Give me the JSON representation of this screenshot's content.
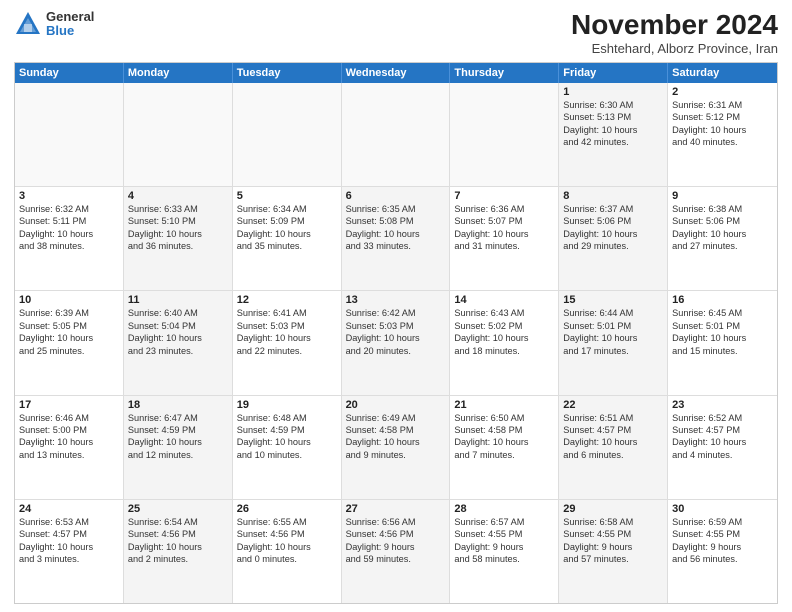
{
  "logo": {
    "general": "General",
    "blue": "Blue"
  },
  "header": {
    "month": "November 2024",
    "location": "Eshtehard, Alborz Province, Iran"
  },
  "weekdays": [
    "Sunday",
    "Monday",
    "Tuesday",
    "Wednesday",
    "Thursday",
    "Friday",
    "Saturday"
  ],
  "rows": [
    [
      {
        "day": "",
        "info": "",
        "empty": true
      },
      {
        "day": "",
        "info": "",
        "empty": true
      },
      {
        "day": "",
        "info": "",
        "empty": true
      },
      {
        "day": "",
        "info": "",
        "empty": true
      },
      {
        "day": "",
        "info": "",
        "empty": true
      },
      {
        "day": "1",
        "info": "Sunrise: 6:30 AM\nSunset: 5:13 PM\nDaylight: 10 hours\nand 42 minutes."
      },
      {
        "day": "2",
        "info": "Sunrise: 6:31 AM\nSunset: 5:12 PM\nDaylight: 10 hours\nand 40 minutes."
      }
    ],
    [
      {
        "day": "3",
        "info": "Sunrise: 6:32 AM\nSunset: 5:11 PM\nDaylight: 10 hours\nand 38 minutes."
      },
      {
        "day": "4",
        "info": "Sunrise: 6:33 AM\nSunset: 5:10 PM\nDaylight: 10 hours\nand 36 minutes."
      },
      {
        "day": "5",
        "info": "Sunrise: 6:34 AM\nSunset: 5:09 PM\nDaylight: 10 hours\nand 35 minutes."
      },
      {
        "day": "6",
        "info": "Sunrise: 6:35 AM\nSunset: 5:08 PM\nDaylight: 10 hours\nand 33 minutes."
      },
      {
        "day": "7",
        "info": "Sunrise: 6:36 AM\nSunset: 5:07 PM\nDaylight: 10 hours\nand 31 minutes."
      },
      {
        "day": "8",
        "info": "Sunrise: 6:37 AM\nSunset: 5:06 PM\nDaylight: 10 hours\nand 29 minutes."
      },
      {
        "day": "9",
        "info": "Sunrise: 6:38 AM\nSunset: 5:06 PM\nDaylight: 10 hours\nand 27 minutes."
      }
    ],
    [
      {
        "day": "10",
        "info": "Sunrise: 6:39 AM\nSunset: 5:05 PM\nDaylight: 10 hours\nand 25 minutes."
      },
      {
        "day": "11",
        "info": "Sunrise: 6:40 AM\nSunset: 5:04 PM\nDaylight: 10 hours\nand 23 minutes."
      },
      {
        "day": "12",
        "info": "Sunrise: 6:41 AM\nSunset: 5:03 PM\nDaylight: 10 hours\nand 22 minutes."
      },
      {
        "day": "13",
        "info": "Sunrise: 6:42 AM\nSunset: 5:03 PM\nDaylight: 10 hours\nand 20 minutes."
      },
      {
        "day": "14",
        "info": "Sunrise: 6:43 AM\nSunset: 5:02 PM\nDaylight: 10 hours\nand 18 minutes."
      },
      {
        "day": "15",
        "info": "Sunrise: 6:44 AM\nSunset: 5:01 PM\nDaylight: 10 hours\nand 17 minutes."
      },
      {
        "day": "16",
        "info": "Sunrise: 6:45 AM\nSunset: 5:01 PM\nDaylight: 10 hours\nand 15 minutes."
      }
    ],
    [
      {
        "day": "17",
        "info": "Sunrise: 6:46 AM\nSunset: 5:00 PM\nDaylight: 10 hours\nand 13 minutes."
      },
      {
        "day": "18",
        "info": "Sunrise: 6:47 AM\nSunset: 4:59 PM\nDaylight: 10 hours\nand 12 minutes."
      },
      {
        "day": "19",
        "info": "Sunrise: 6:48 AM\nSunset: 4:59 PM\nDaylight: 10 hours\nand 10 minutes."
      },
      {
        "day": "20",
        "info": "Sunrise: 6:49 AM\nSunset: 4:58 PM\nDaylight: 10 hours\nand 9 minutes."
      },
      {
        "day": "21",
        "info": "Sunrise: 6:50 AM\nSunset: 4:58 PM\nDaylight: 10 hours\nand 7 minutes."
      },
      {
        "day": "22",
        "info": "Sunrise: 6:51 AM\nSunset: 4:57 PM\nDaylight: 10 hours\nand 6 minutes."
      },
      {
        "day": "23",
        "info": "Sunrise: 6:52 AM\nSunset: 4:57 PM\nDaylight: 10 hours\nand 4 minutes."
      }
    ],
    [
      {
        "day": "24",
        "info": "Sunrise: 6:53 AM\nSunset: 4:57 PM\nDaylight: 10 hours\nand 3 minutes."
      },
      {
        "day": "25",
        "info": "Sunrise: 6:54 AM\nSunset: 4:56 PM\nDaylight: 10 hours\nand 2 minutes."
      },
      {
        "day": "26",
        "info": "Sunrise: 6:55 AM\nSunset: 4:56 PM\nDaylight: 10 hours\nand 0 minutes."
      },
      {
        "day": "27",
        "info": "Sunrise: 6:56 AM\nSunset: 4:56 PM\nDaylight: 9 hours\nand 59 minutes."
      },
      {
        "day": "28",
        "info": "Sunrise: 6:57 AM\nSunset: 4:55 PM\nDaylight: 9 hours\nand 58 minutes."
      },
      {
        "day": "29",
        "info": "Sunrise: 6:58 AM\nSunset: 4:55 PM\nDaylight: 9 hours\nand 57 minutes."
      },
      {
        "day": "30",
        "info": "Sunrise: 6:59 AM\nSunset: 4:55 PM\nDaylight: 9 hours\nand 56 minutes."
      }
    ]
  ]
}
